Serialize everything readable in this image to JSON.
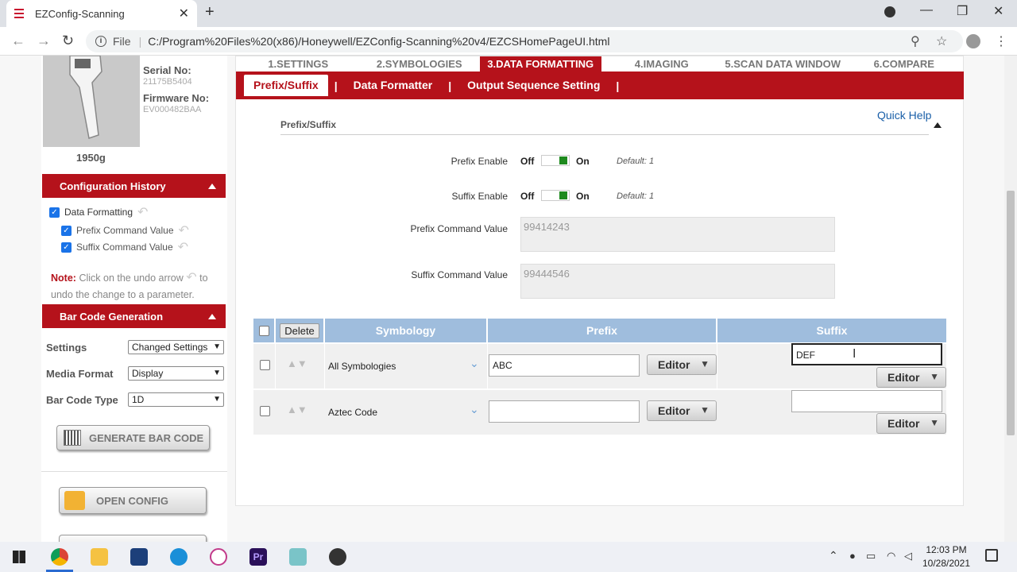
{
  "browser": {
    "tab_title": "EZConfig-Scanning",
    "address_prefix": "File",
    "url": "C:/Program%20Files%20(x86)/Honeywell/EZConfig-Scanning%20v4/EZCSHomePageUI.html"
  },
  "device": {
    "serial_label": "Serial No:",
    "serial_value": "21175B5404",
    "firmware_label": "Firmware No:",
    "firmware_value": "EV000482BAA",
    "model": "1950g"
  },
  "config_history": {
    "title": "Configuration History",
    "items": [
      "Data Formatting",
      "Prefix Command Value",
      "Suffix Command Value"
    ],
    "note_label": "Note:",
    "note_text_1": "Click on the undo arrow",
    "note_text_2": "to",
    "note_text_3": "undo the change to a parameter."
  },
  "barcode_gen": {
    "title": "Bar Code Generation",
    "settings_label": "Settings",
    "settings_value": "Changed Settings",
    "media_label": "Media Format",
    "media_value": "Display",
    "type_label": "Bar Code Type",
    "type_value": "1D",
    "generate_label": "GENERATE BAR CODE",
    "open_config_label": "OPEN CONFIG"
  },
  "main_tabs": [
    "1.SETTINGS",
    "2.SYMBOLOGIES",
    "3.DATA FORMATTING",
    "4.IMAGING",
    "5.SCAN DATA WINDOW",
    "6.COMPARE"
  ],
  "sub_tabs": [
    "Prefix/Suffix",
    "Data Formatter",
    "Output Sequence Setting"
  ],
  "section": {
    "title": "Prefix/Suffix",
    "quick_help": "Quick Help"
  },
  "fields": {
    "prefix_enable_label": "Prefix Enable",
    "suffix_enable_label": "Suffix Enable",
    "off_label": "Off",
    "on_label": "On",
    "default_label": "Default: 1",
    "prefix_cmd_label": "Prefix Command Value",
    "prefix_cmd_value": "99414243",
    "suffix_cmd_label": "Suffix Command Value",
    "suffix_cmd_value": "99444546"
  },
  "table": {
    "delete_label": "Delete",
    "headers": [
      "Symbology",
      "Prefix",
      "Suffix"
    ],
    "editor_label": "Editor",
    "rows": [
      {
        "symbology": "All Symbologies",
        "prefix": "ABC",
        "suffix": "DEF"
      },
      {
        "symbology": "Aztec Code",
        "prefix": "",
        "suffix": ""
      }
    ]
  },
  "taskbar": {
    "time": "12:03 PM",
    "date": "10/28/2021"
  }
}
